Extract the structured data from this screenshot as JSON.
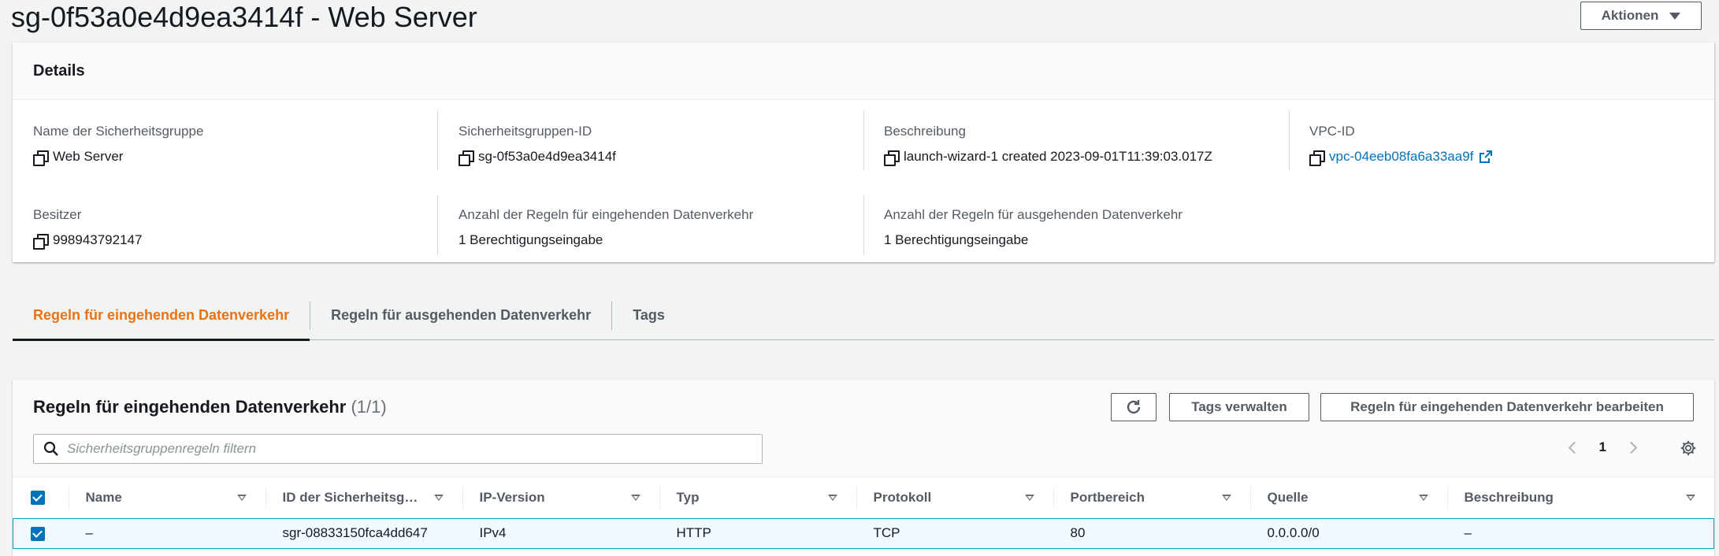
{
  "header": {
    "title": "sg-0f53a0e4d9ea3414f - Web Server",
    "actions_label": "Aktionen"
  },
  "details": {
    "title": "Details",
    "fields": [
      {
        "label": "Name der Sicherheitsgruppe",
        "value": "Web Server"
      },
      {
        "label": "Sicherheitsgruppen-ID",
        "value": "sg-0f53a0e4d9ea3414f"
      },
      {
        "label": "Beschreibung",
        "value": "launch-wizard-1 created 2023-09-01T11:39:03.017Z"
      },
      {
        "label": "VPC-ID",
        "value": "vpc-04eeb08fa6a33aa9f"
      },
      {
        "label": "Besitzer",
        "value": "998943792147"
      },
      {
        "label": "Anzahl der Regeln für eingehenden Datenverkehr",
        "value": "1 Berechtigungseingabe"
      },
      {
        "label": "Anzahl der Regeln für ausgehenden Datenverkehr",
        "value": "1 Berechtigungseingabe"
      }
    ]
  },
  "tabs": [
    {
      "label": "Regeln für eingehenden Datenverkehr",
      "active": true
    },
    {
      "label": "Regeln für ausgehenden Datenverkehr",
      "active": false
    },
    {
      "label": "Tags",
      "active": false
    }
  ],
  "rules": {
    "title": "Regeln für eingehenden Datenverkehr",
    "count": "(1/1)",
    "manage_tags_label": "Tags verwalten",
    "edit_rules_label": "Regeln für eingehenden Datenverkehr bearbeiten",
    "search_placeholder": "Sicherheitsgruppenregeln filtern",
    "page": "1",
    "columns": [
      "Name",
      "ID der Sicherheitsg…",
      "IP-Version",
      "Typ",
      "Protokoll",
      "Portbereich",
      "Quelle",
      "Beschreibung"
    ],
    "rows": [
      {
        "name": "–",
        "id": "sgr-08833150fca4dd647",
        "ip_version": "IPv4",
        "type": "HTTP",
        "protocol": "TCP",
        "port_range": "80",
        "source": "0.0.0.0/0",
        "description": "–",
        "selected": true
      }
    ]
  },
  "colors": {
    "accent": "#ec7211",
    "link": "#0073bb",
    "primary_check": "#0073bb"
  }
}
